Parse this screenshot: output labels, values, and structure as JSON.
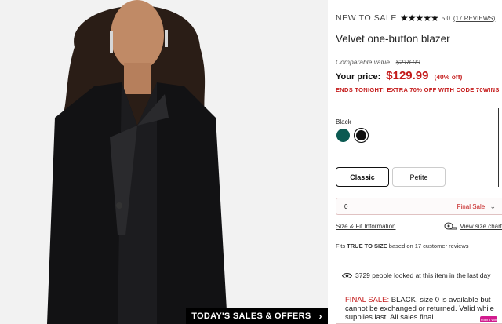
{
  "promo_bar": {
    "label": "TODAY'S SALES & OFFERS"
  },
  "product": {
    "badge": "NEW TO SALE",
    "stars": "★★★★★",
    "rating": "5.0",
    "reviews_link": "(17 REVIEWS)",
    "title": "Velvet one-button blazer",
    "comparable_label": "Comparable value:",
    "comparable_value": "$218.00",
    "price_label": "Your price:",
    "price": "$129.99",
    "discount": "(40% off)",
    "promo_text": "ENDS TONIGHT! EXTRA 70% OFF WITH CODE 70WINS"
  },
  "color": {
    "selected_name": "Black",
    "swatches": [
      "green",
      "black"
    ],
    "colors": {
      "green": "#0b5a52",
      "black": "#111111",
      "sale_red": "#c41a1a"
    }
  },
  "fit": {
    "options": [
      "Classic",
      "Petite"
    ],
    "selected": "Classic"
  },
  "size_select": {
    "value": "0",
    "status": "Final Sale"
  },
  "links": {
    "size_fit": "Size & Fit Information",
    "size_chart": "View size chart"
  },
  "fits": {
    "prefix": "Fits ",
    "strong": "TRUE TO SIZE",
    "middle": " based on ",
    "link": "17 customer reviews"
  },
  "viewers": {
    "text": "3729 people looked at this item in the last day"
  },
  "final_sale": {
    "label": "FINAL SALE:",
    "text": " BLACK, size 0 is available but cannot be exchanged or returned. Valid while supplies last. All sales final."
  },
  "chat_badge": "Point 3 Win"
}
